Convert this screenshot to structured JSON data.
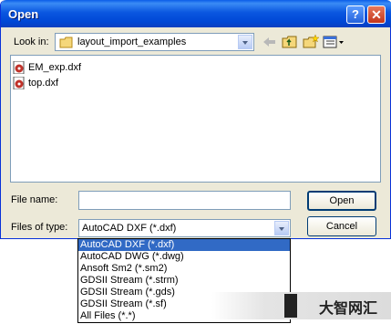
{
  "window": {
    "title": "Open",
    "help_glyph": "?",
    "close_glyph": "✕"
  },
  "look_in": {
    "label": "Look in:",
    "value": "layout_import_examples"
  },
  "toolbar": {
    "icons": [
      "back-icon",
      "up-folder-icon",
      "new-folder-icon",
      "views-menu-icon"
    ]
  },
  "files": [
    {
      "name": "EM_exp.dxf",
      "icon": "dxf-file-icon"
    },
    {
      "name": "top.dxf",
      "icon": "dxf-file-icon"
    }
  ],
  "file_name": {
    "label": "File name:",
    "value": ""
  },
  "files_of_type": {
    "label": "Files of type:",
    "value": "AutoCAD DXF (*.dxf)"
  },
  "buttons": {
    "open": "Open",
    "cancel": "Cancel"
  },
  "type_options": [
    "AutoCAD DXF (*.dxf)",
    "AutoCAD DWG (*.dwg)",
    "Ansoft Sm2 (*.sm2)",
    "GDSII Stream (*.strm)",
    "GDSII Stream (*.gds)",
    "GDSII Stream (*.sf)",
    "All Files (*.*)"
  ],
  "selected_option_index": 0,
  "watermark": {
    "text": "大智网汇"
  },
  "colors": {
    "title_bar": "#0a57e0",
    "selection": "#316ac5",
    "dialog_bg": "#ece9d8"
  }
}
